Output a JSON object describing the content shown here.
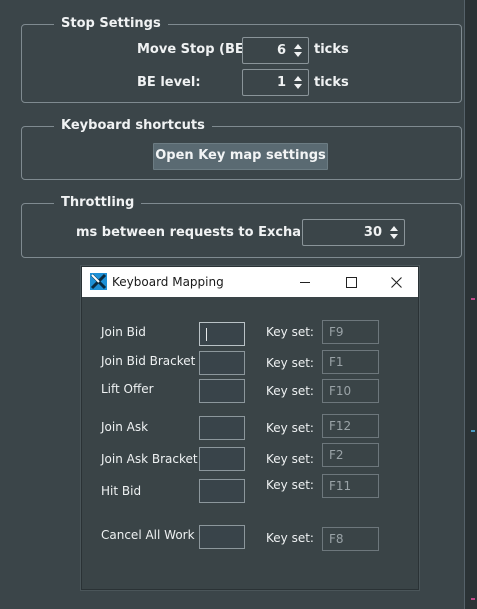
{
  "stop_settings": {
    "title": "Stop Settings",
    "move_stop_label": "Move Stop (BE):",
    "move_stop_value": "6",
    "move_stop_unit": "ticks",
    "be_level_label": "BE level:",
    "be_level_value": "1",
    "be_level_unit": "ticks"
  },
  "keyboard_shortcuts": {
    "title": "Keyboard shortcuts",
    "open_button": "Open Key map settings"
  },
  "throttling": {
    "title": "Throttling",
    "label": "ms between requests to Exchange:",
    "value": "30"
  },
  "dialog": {
    "title": "Keyboard Mapping",
    "icons": {
      "app": "app-logo-icon",
      "minimize": "minimize-icon",
      "maximize": "maximize-icon",
      "close": "close-icon"
    },
    "keyset_label": "Key set:",
    "rows": [
      {
        "label": "Join Bid",
        "key": "F9"
      },
      {
        "label": "Join Bid Bracket",
        "key": "F1"
      },
      {
        "label": "Lift Offer",
        "key": "F10"
      },
      {
        "label": "Join Ask",
        "key": "F12"
      },
      {
        "label": "Join Ask Bracket",
        "key": "F2"
      },
      {
        "label": "Hit Bid",
        "key": "F11"
      },
      {
        "label": "Cancel All Work",
        "key": "F8"
      }
    ]
  },
  "colors": {
    "background": "#3b4549",
    "button": "#5a6a72",
    "border": "#7f8a90",
    "titlebar": "#ffffff"
  }
}
